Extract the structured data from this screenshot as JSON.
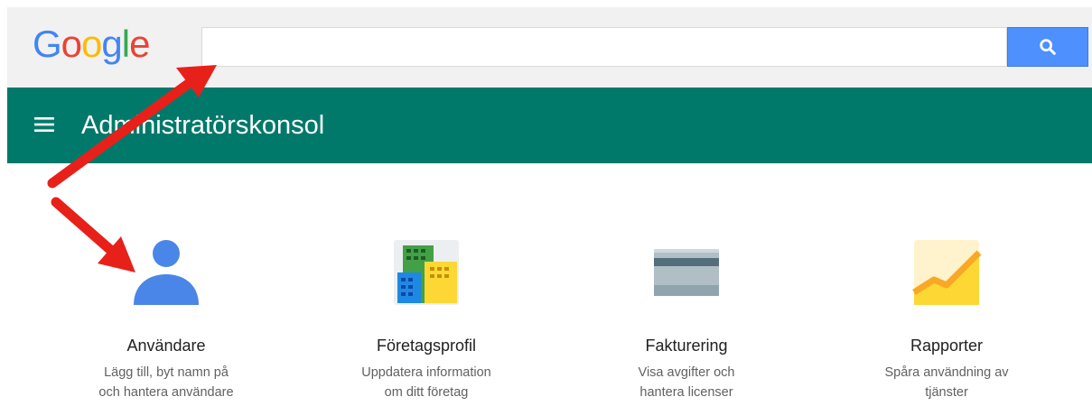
{
  "logo": {
    "text": "Google",
    "letters": [
      "G",
      "o",
      "o",
      "g",
      "l",
      "e"
    ],
    "colors": [
      "#4285f4",
      "#ea4335",
      "#fbbc05",
      "#4285f4",
      "#34a853",
      "#ea4335"
    ]
  },
  "search": {
    "value": "",
    "placeholder": "",
    "button_icon": "search-icon"
  },
  "appbar": {
    "title": "Administratörskonsol",
    "menu_icon": "menu-icon",
    "color": "#00796b"
  },
  "cards": [
    {
      "icon": "user-icon",
      "title": "Användare",
      "desc_line1": "Lägg till, byt namn på",
      "desc_line2": "och hantera användare"
    },
    {
      "icon": "company-building-icon",
      "title": "Företagsprofil",
      "desc_line1": "Uppdatera information",
      "desc_line2": "om ditt företag"
    },
    {
      "icon": "credit-card-icon",
      "title": "Fakturering",
      "desc_line1": "Visa avgifter och",
      "desc_line2": "hantera licenser"
    },
    {
      "icon": "reports-chart-icon",
      "title": "Rapporter",
      "desc_line1": "Spåra användning av",
      "desc_line2": "tjänster"
    }
  ],
  "annotation": {
    "arrow_color": "#e8201a"
  }
}
